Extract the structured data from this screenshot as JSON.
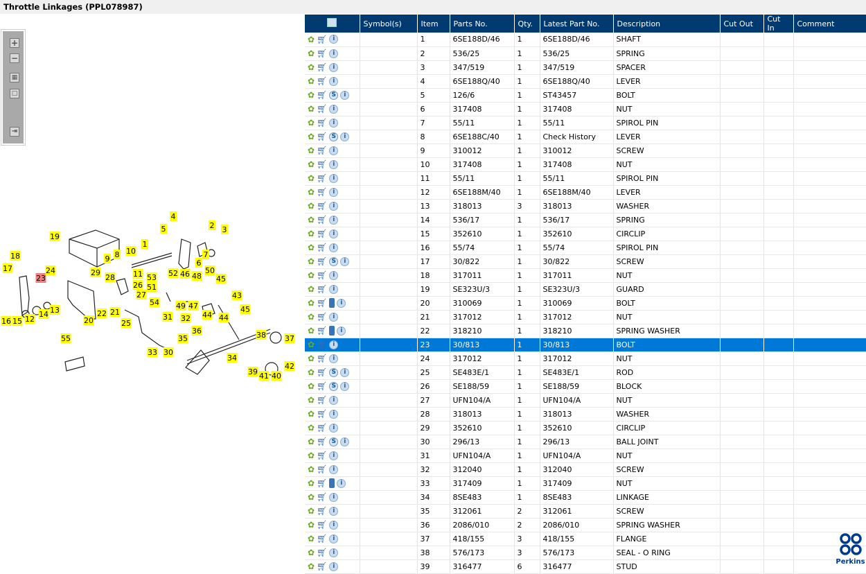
{
  "title": "Throttle Linkages (PPL078987)",
  "toolbar": {
    "zoom_in": "+",
    "zoom_out": "−",
    "fit": "▦",
    "actual": "□",
    "export": "⇥"
  },
  "columns": [
    "",
    "Symbol(s)",
    "Item",
    "Parts No.",
    "Qty.",
    "Latest Part No.",
    "Description",
    "Cut Out",
    "Cut In",
    "Comment"
  ],
  "selected_item": "23",
  "rows": [
    [
      "1",
      "6SE188D/46",
      "1",
      "6SE188D/46",
      "SHAFT",
      ""
    ],
    [
      "2",
      "536/25",
      "1",
      "536/25",
      "SPRING",
      ""
    ],
    [
      "3",
      "347/519",
      "1",
      "347/519",
      "SPACER",
      ""
    ],
    [
      "4",
      "6SE188Q/40",
      "1",
      "6SE188Q/40",
      "LEVER",
      ""
    ],
    [
      "5",
      "126/6",
      "1",
      "ST43457",
      "BOLT",
      "s"
    ],
    [
      "6",
      "317408",
      "1",
      "317408",
      "NUT",
      ""
    ],
    [
      "7",
      "55/11",
      "1",
      "55/11",
      "SPIROL PIN",
      ""
    ],
    [
      "8",
      "6SE188C/40",
      "1",
      "Check History",
      "LEVER",
      "s"
    ],
    [
      "9",
      "310012",
      "1",
      "310012",
      "SCREW",
      ""
    ],
    [
      "10",
      "317408",
      "1",
      "317408",
      "NUT",
      ""
    ],
    [
      "11",
      "55/11",
      "1",
      "55/11",
      "SPIROL PIN",
      ""
    ],
    [
      "12",
      "6SE188M/40",
      "1",
      "6SE188M/40",
      "LEVER",
      ""
    ],
    [
      "13",
      "318013",
      "3",
      "318013",
      "WASHER",
      ""
    ],
    [
      "14",
      "536/17",
      "1",
      "536/17",
      "SPRING",
      ""
    ],
    [
      "15",
      "352610",
      "1",
      "352610",
      "CIRCLIP",
      ""
    ],
    [
      "16",
      "55/74",
      "1",
      "55/74",
      "SPIROL PIN",
      ""
    ],
    [
      "17",
      "30/822",
      "1",
      "30/822",
      "SCREW",
      "s"
    ],
    [
      "18",
      "317011",
      "1",
      "317011",
      "NUT",
      ""
    ],
    [
      "19",
      "SE323U/3",
      "1",
      "SE323U/3",
      "GUARD",
      ""
    ],
    [
      "20",
      "310069",
      "1",
      "310069",
      "BOLT",
      "b"
    ],
    [
      "21",
      "317012",
      "1",
      "317012",
      "NUT",
      ""
    ],
    [
      "22",
      "318210",
      "1",
      "318210",
      "SPRING WASHER",
      "b"
    ],
    [
      "23",
      "30/813",
      "1",
      "30/813",
      "BOLT",
      ""
    ],
    [
      "24",
      "317012",
      "1",
      "317012",
      "NUT",
      ""
    ],
    [
      "25",
      "SE483E/1",
      "1",
      "SE483E/1",
      "ROD",
      "s"
    ],
    [
      "26",
      "SE188/59",
      "1",
      "SE188/59",
      "BLOCK",
      "s"
    ],
    [
      "27",
      "UFN104/A",
      "1",
      "UFN104/A",
      "NUT",
      ""
    ],
    [
      "28",
      "318013",
      "1",
      "318013",
      "WASHER",
      ""
    ],
    [
      "29",
      "352610",
      "1",
      "352610",
      "CIRCLIP",
      ""
    ],
    [
      "30",
      "296/13",
      "1",
      "296/13",
      "BALL JOINT",
      "s"
    ],
    [
      "31",
      "UFN104/A",
      "1",
      "UFN104/A",
      "NUT",
      ""
    ],
    [
      "32",
      "312040",
      "1",
      "312040",
      "SCREW",
      ""
    ],
    [
      "33",
      "317409",
      "1",
      "317409",
      "NUT",
      "b"
    ],
    [
      "34",
      "8SE483",
      "1",
      "8SE483",
      "LINKAGE",
      ""
    ],
    [
      "35",
      "312061",
      "2",
      "312061",
      "SCREW",
      ""
    ],
    [
      "36",
      "2086/010",
      "2",
      "2086/010",
      "SPRING WASHER",
      ""
    ],
    [
      "37",
      "418/155",
      "3",
      "418/155",
      "FLANGE",
      ""
    ],
    [
      "38",
      "576/173",
      "3",
      "576/173",
      "SEAL - O RING",
      ""
    ],
    [
      "39",
      "316477",
      "6",
      "316477",
      "STUD",
      ""
    ]
  ],
  "callouts": [
    [
      "1",
      209,
      352
    ],
    [
      "2",
      306,
      325
    ],
    [
      "3",
      324,
      331
    ],
    [
      "4",
      250,
      312
    ],
    [
      "5",
      236,
      330
    ],
    [
      "6",
      287,
      379
    ],
    [
      "7",
      297,
      367
    ],
    [
      "8",
      169,
      367
    ],
    [
      "9",
      155,
      373
    ],
    [
      "10",
      189,
      362
    ],
    [
      "11",
      199,
      395
    ],
    [
      "12",
      43,
      460
    ],
    [
      "13",
      79,
      447
    ],
    [
      "14",
      63,
      453
    ],
    [
      "15",
      25,
      463
    ],
    [
      "16",
      9,
      463
    ],
    [
      "17",
      11,
      387
    ],
    [
      "18",
      22,
      369
    ],
    [
      "19",
      79,
      341
    ],
    [
      "20",
      128,
      462
    ],
    [
      "21",
      166,
      450
    ],
    [
      "22",
      147,
      452
    ],
    [
      "23",
      59,
      401
    ],
    [
      "24",
      73,
      390
    ],
    [
      "25",
      182,
      466
    ],
    [
      "26",
      199,
      411
    ],
    [
      "27",
      204,
      425
    ],
    [
      "28",
      159,
      400
    ],
    [
      "29",
      138,
      393
    ],
    [
      "30",
      243,
      508
    ],
    [
      "31",
      242,
      457
    ],
    [
      "32",
      268,
      459
    ],
    [
      "33",
      220,
      508
    ],
    [
      "34",
      335,
      516
    ],
    [
      "35",
      264,
      488
    ],
    [
      "36",
      284,
      477
    ],
    [
      "37",
      418,
      488
    ],
    [
      "38",
      377,
      483
    ],
    [
      "39",
      365,
      536
    ],
    [
      "40",
      399,
      542
    ],
    [
      "41",
      381,
      542
    ],
    [
      "42",
      418,
      528
    ],
    [
      "43",
      342,
      426
    ],
    [
      "44",
      299,
      454
    ],
    [
      "44",
      323,
      458
    ],
    [
      "45",
      319,
      402
    ],
    [
      "45",
      354,
      446
    ],
    [
      "46",
      267,
      395
    ],
    [
      "47",
      279,
      441
    ],
    [
      "48",
      284,
      398
    ],
    [
      "49",
      261,
      441
    ],
    [
      "50",
      303,
      390
    ],
    [
      "51",
      219,
      414
    ],
    [
      "52",
      250,
      394
    ],
    [
      "53",
      219,
      400
    ],
    [
      "54",
      223,
      436
    ],
    [
      "55",
      95,
      488
    ]
  ],
  "brand": {
    "name": "Perkins",
    "color": "#003a8c"
  },
  "colors": {
    "header": "#003a70",
    "selected": "#0078d7",
    "callout": "#ffff00",
    "callout_selected": "#f08080"
  }
}
